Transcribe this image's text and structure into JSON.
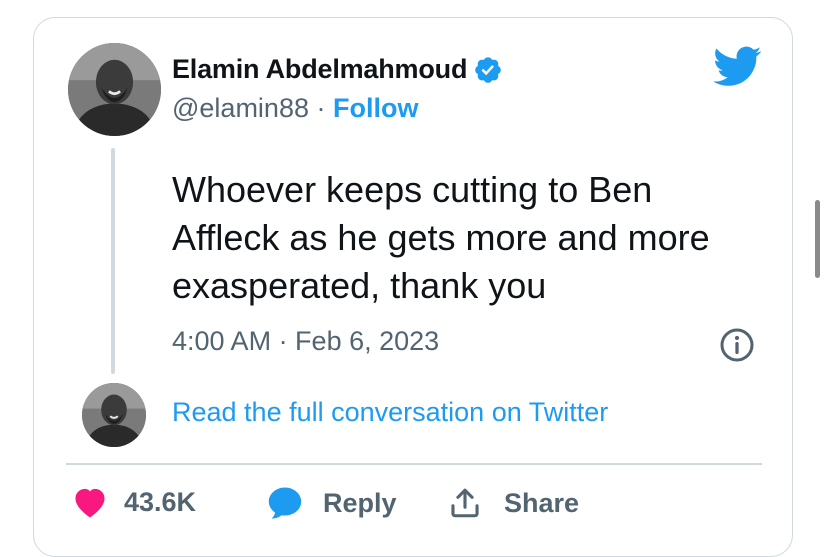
{
  "author": {
    "name": "Elamin Abdelmahmoud",
    "handle": "@elamin88",
    "separator": "·",
    "follow_label": "Follow",
    "avatar_icon": "profile-photo",
    "verified_icon": "verified-badge-icon"
  },
  "tweet": {
    "text_lines": [
      "Whoever keeps cutting to Ben",
      "Affleck as he gets more and more",
      "exasperated, thank you"
    ],
    "timestamp": "4:00 AM · Feb 6, 2023"
  },
  "conversation": {
    "link_text": "Read the full conversation on Twitter"
  },
  "actions": {
    "likes_count": "43.6K",
    "reply_label": "Reply",
    "share_label": "Share"
  },
  "colors": {
    "twitter_blue": "#1d9bf0",
    "like_pink": "#f91880",
    "text": "#0f1419",
    "muted": "#536471",
    "border": "#cfd9de"
  }
}
